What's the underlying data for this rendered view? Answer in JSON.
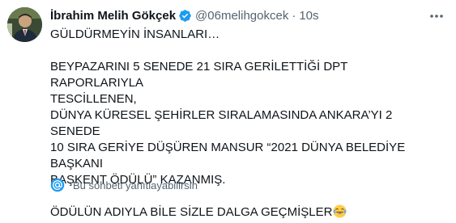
{
  "author": {
    "display_name": "İbrahim Melih Gökçek",
    "handle": "@06melihgokcek",
    "separator": "·",
    "timestamp": "10s"
  },
  "tweet": {
    "line1": "GÜLDÜRMEYİN İNSANLARI…",
    "para2": "BEYPAZARINI 5 SENEDE 21 SIRA GERİLETTİĞİ DPT RAPORLARIYLA\nTESCİLLENEN,\nDÜNYA KÜRESEL ŞEHİRLER SIRALAMASINDA  ANKARA’YI 2 SENEDE\n10 SIRA GERİYE DÜŞÜREN MANSUR “2021 DÜNYA BELEDİYE BAŞKANI\nBAŞKENT ÖDÜLÜ” KAZANMIŞ.",
    "para3": "ÖDÜLÜN ADIYLA BİLE SİZLE DALGA GEÇMİŞLER",
    "emoji": "face-with-tears-of-joy"
  },
  "reply_restriction": {
    "text": "Bu sohbeti yanıtlayabilirsin",
    "icon": "at-sign-icon"
  },
  "colors": {
    "text": "#0f1419",
    "secondary": "#536471",
    "verified": "#1d9bf0",
    "accent": "#1d9bf0"
  },
  "icons": {
    "verified": "verified-badge-icon",
    "more": "more-options-icon"
  }
}
